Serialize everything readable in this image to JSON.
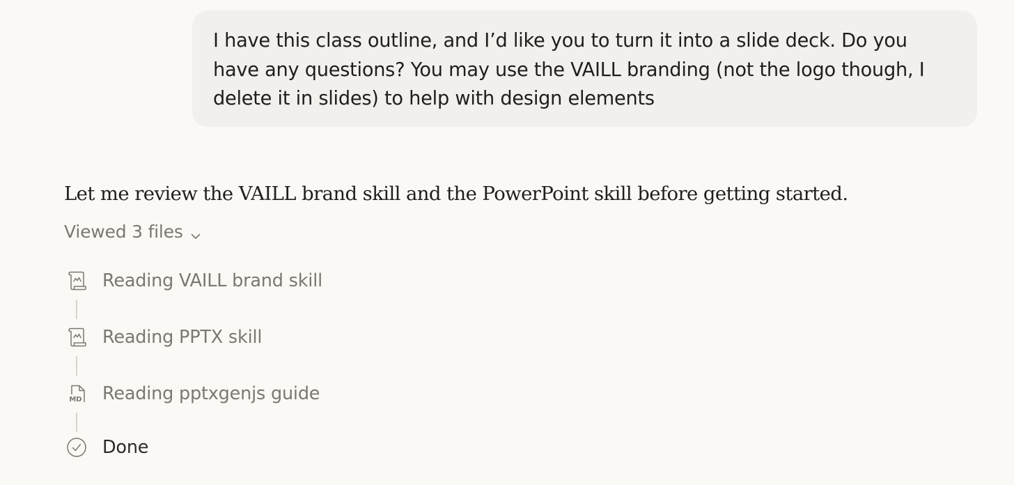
{
  "user_message": {
    "lines": [
      "I have this class outline, and I’d like you to turn it into a slide deck. Do you",
      "have any questions? You may use the VAILL branding (not the logo though, I",
      "delete it in slides) to help with design elements"
    ]
  },
  "assistant_message": {
    "text": "Let me review the VAILL brand skill and the PowerPoint skill before getting started."
  },
  "files_panel": {
    "toggle_label": "Viewed 3 files",
    "steps": [
      {
        "label": "Reading VAILL brand skill",
        "icon": "skill-scroll-icon"
      },
      {
        "label": "Reading PPTX skill",
        "icon": "skill-scroll-icon"
      },
      {
        "label": "Reading pptxgenjs guide",
        "icon": "markdown-file-icon",
        "icon_text": "MD"
      },
      {
        "label": "Done",
        "icon": "check-circle-icon"
      }
    ]
  },
  "colors": {
    "background": "#fbf9f5",
    "bubble": "#f2f0ec",
    "text_primary": "#1f1e1d",
    "text_muted": "#7b7873"
  }
}
